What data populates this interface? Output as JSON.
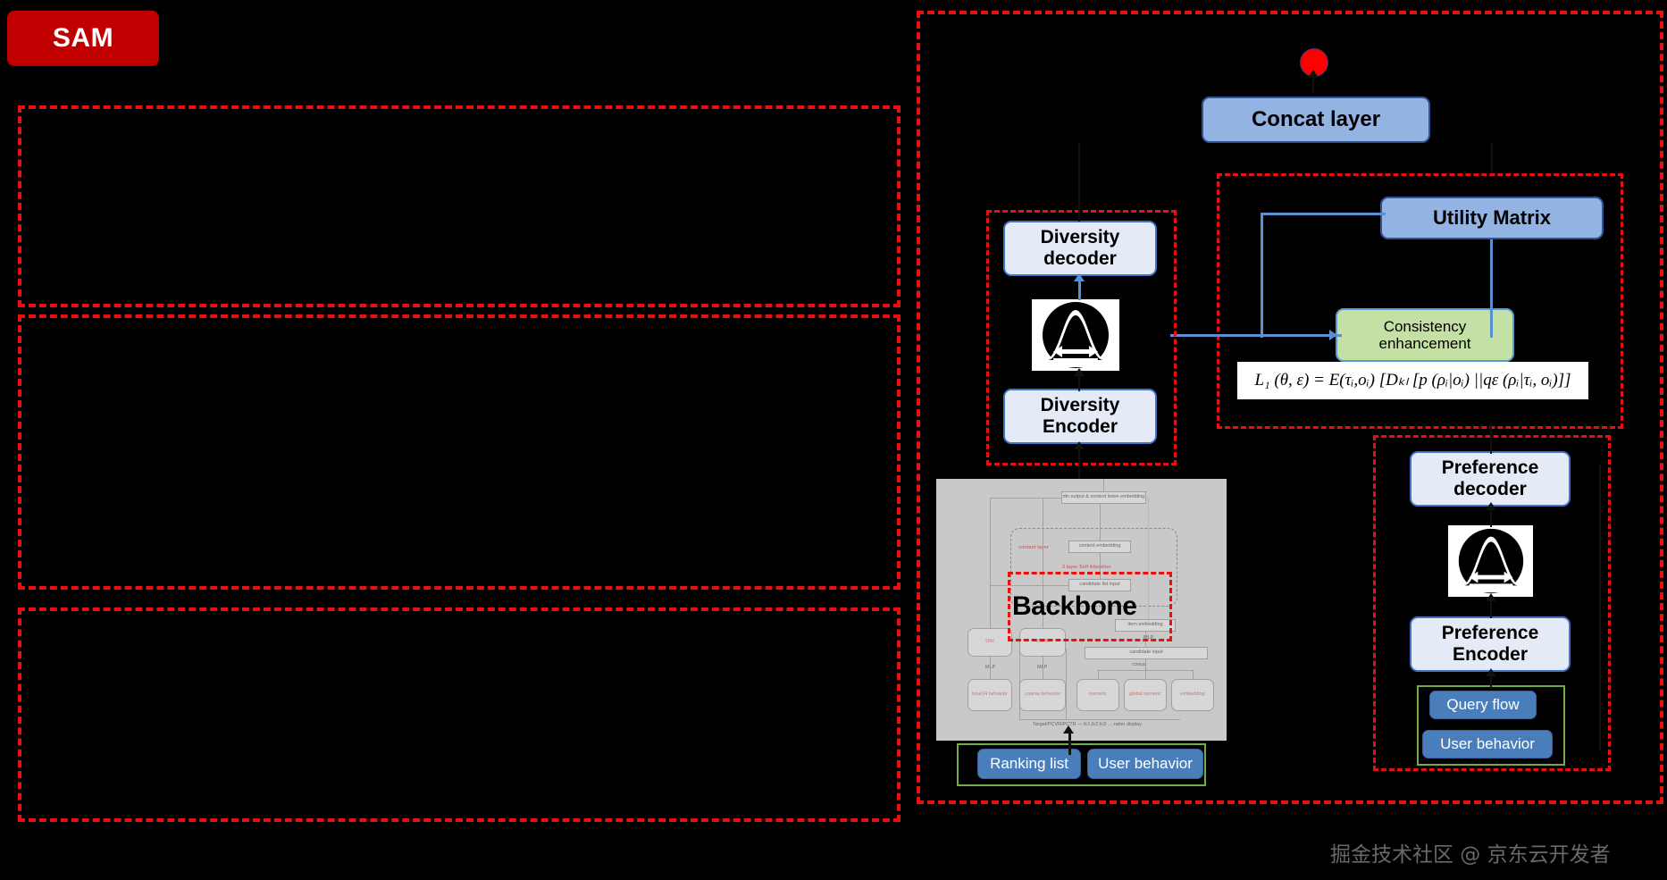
{
  "badge": {
    "label": "SAM"
  },
  "nodes": {
    "concat_layer": "Concat layer",
    "utility_matrix": "Utility Matrix",
    "consistency_enhancement": "Consistency\nenhancement",
    "consistency_line1": "Consistency",
    "consistency_line2": "enhancement",
    "diversity_decoder_l1": "Diversity",
    "diversity_decoder_l2": "decoder",
    "diversity_encoder_l1": "Diversity",
    "diversity_encoder_l2": "Encoder",
    "preference_decoder_l1": "Preference",
    "preference_decoder_l2": "decoder",
    "preference_encoder_l1": "Preference",
    "preference_encoder_l2": "Encoder",
    "query_flow": "Query flow",
    "user_behavior_right": "User behavior",
    "ranking_list": "Ranking list",
    "user_behavior_bottom": "User behavior",
    "backbone_title": "Backbone"
  },
  "formula": {
    "text": "L₁ (θ, ε) = E(τᵢ,oᵢ) [Dₖₗ [p (ρᵢ|oᵢ) ||qε (ρᵢ|τᵢ, oᵢ)]]",
    "parts": {
      "lhs": "L",
      "sub1": "1",
      "args": " (θ, ε) = ",
      "expect": "E",
      "expect_sub": "(τᵢ,oᵢ)",
      "body": " [D",
      "kl_sub": "KL",
      "body2": " [p (ρᵢ|oᵢ) ||q",
      "q_sub": "ε",
      "body3": " (ρᵢ|τᵢ, oᵢ)]]"
    }
  },
  "backbone": {
    "top_box": "din output & context listen embedding",
    "context_layer_label": "context layer",
    "content_embedding": "content embedding",
    "self_attention_label": "3 layer Self Attention",
    "candidate_list_input": "candidate list input",
    "item_embedding": "item embedding",
    "candidate_input": "candidate input",
    "din_box": "DIN",
    "dien_box": "DIEN",
    "mlp_label_1": "MLP",
    "mlp_label_2": "MLP",
    "concat_label_small": "concat",
    "mlp_small": "MLP",
    "hour_behavior": "hour24 behavior",
    "coarse_behavior": "coarse behavior",
    "numeric": "numeric",
    "global_numeric": "global numeric",
    "embedding": "embedding",
    "bottom_caption": "Target/PCVR/PCTR  — fc1,fc2,fc3 … raton display"
  },
  "watermark": {
    "text": "掘金技术社区 @ 京东云开发者"
  },
  "colors": {
    "badge_bg": "#C00000",
    "dashed_red": "#E81010",
    "node_light_blue": "#E4EBF7",
    "node_mid_blue": "#93B3E3",
    "node_green": "#C5E0A5",
    "node_blue_solid": "#4A7EBB",
    "green_frame": "#70AD47",
    "connector_blue": "#5B8FD4",
    "red_dot": "#FF0000",
    "backbone_bg": "#C9C9C9",
    "background": "#000000"
  }
}
